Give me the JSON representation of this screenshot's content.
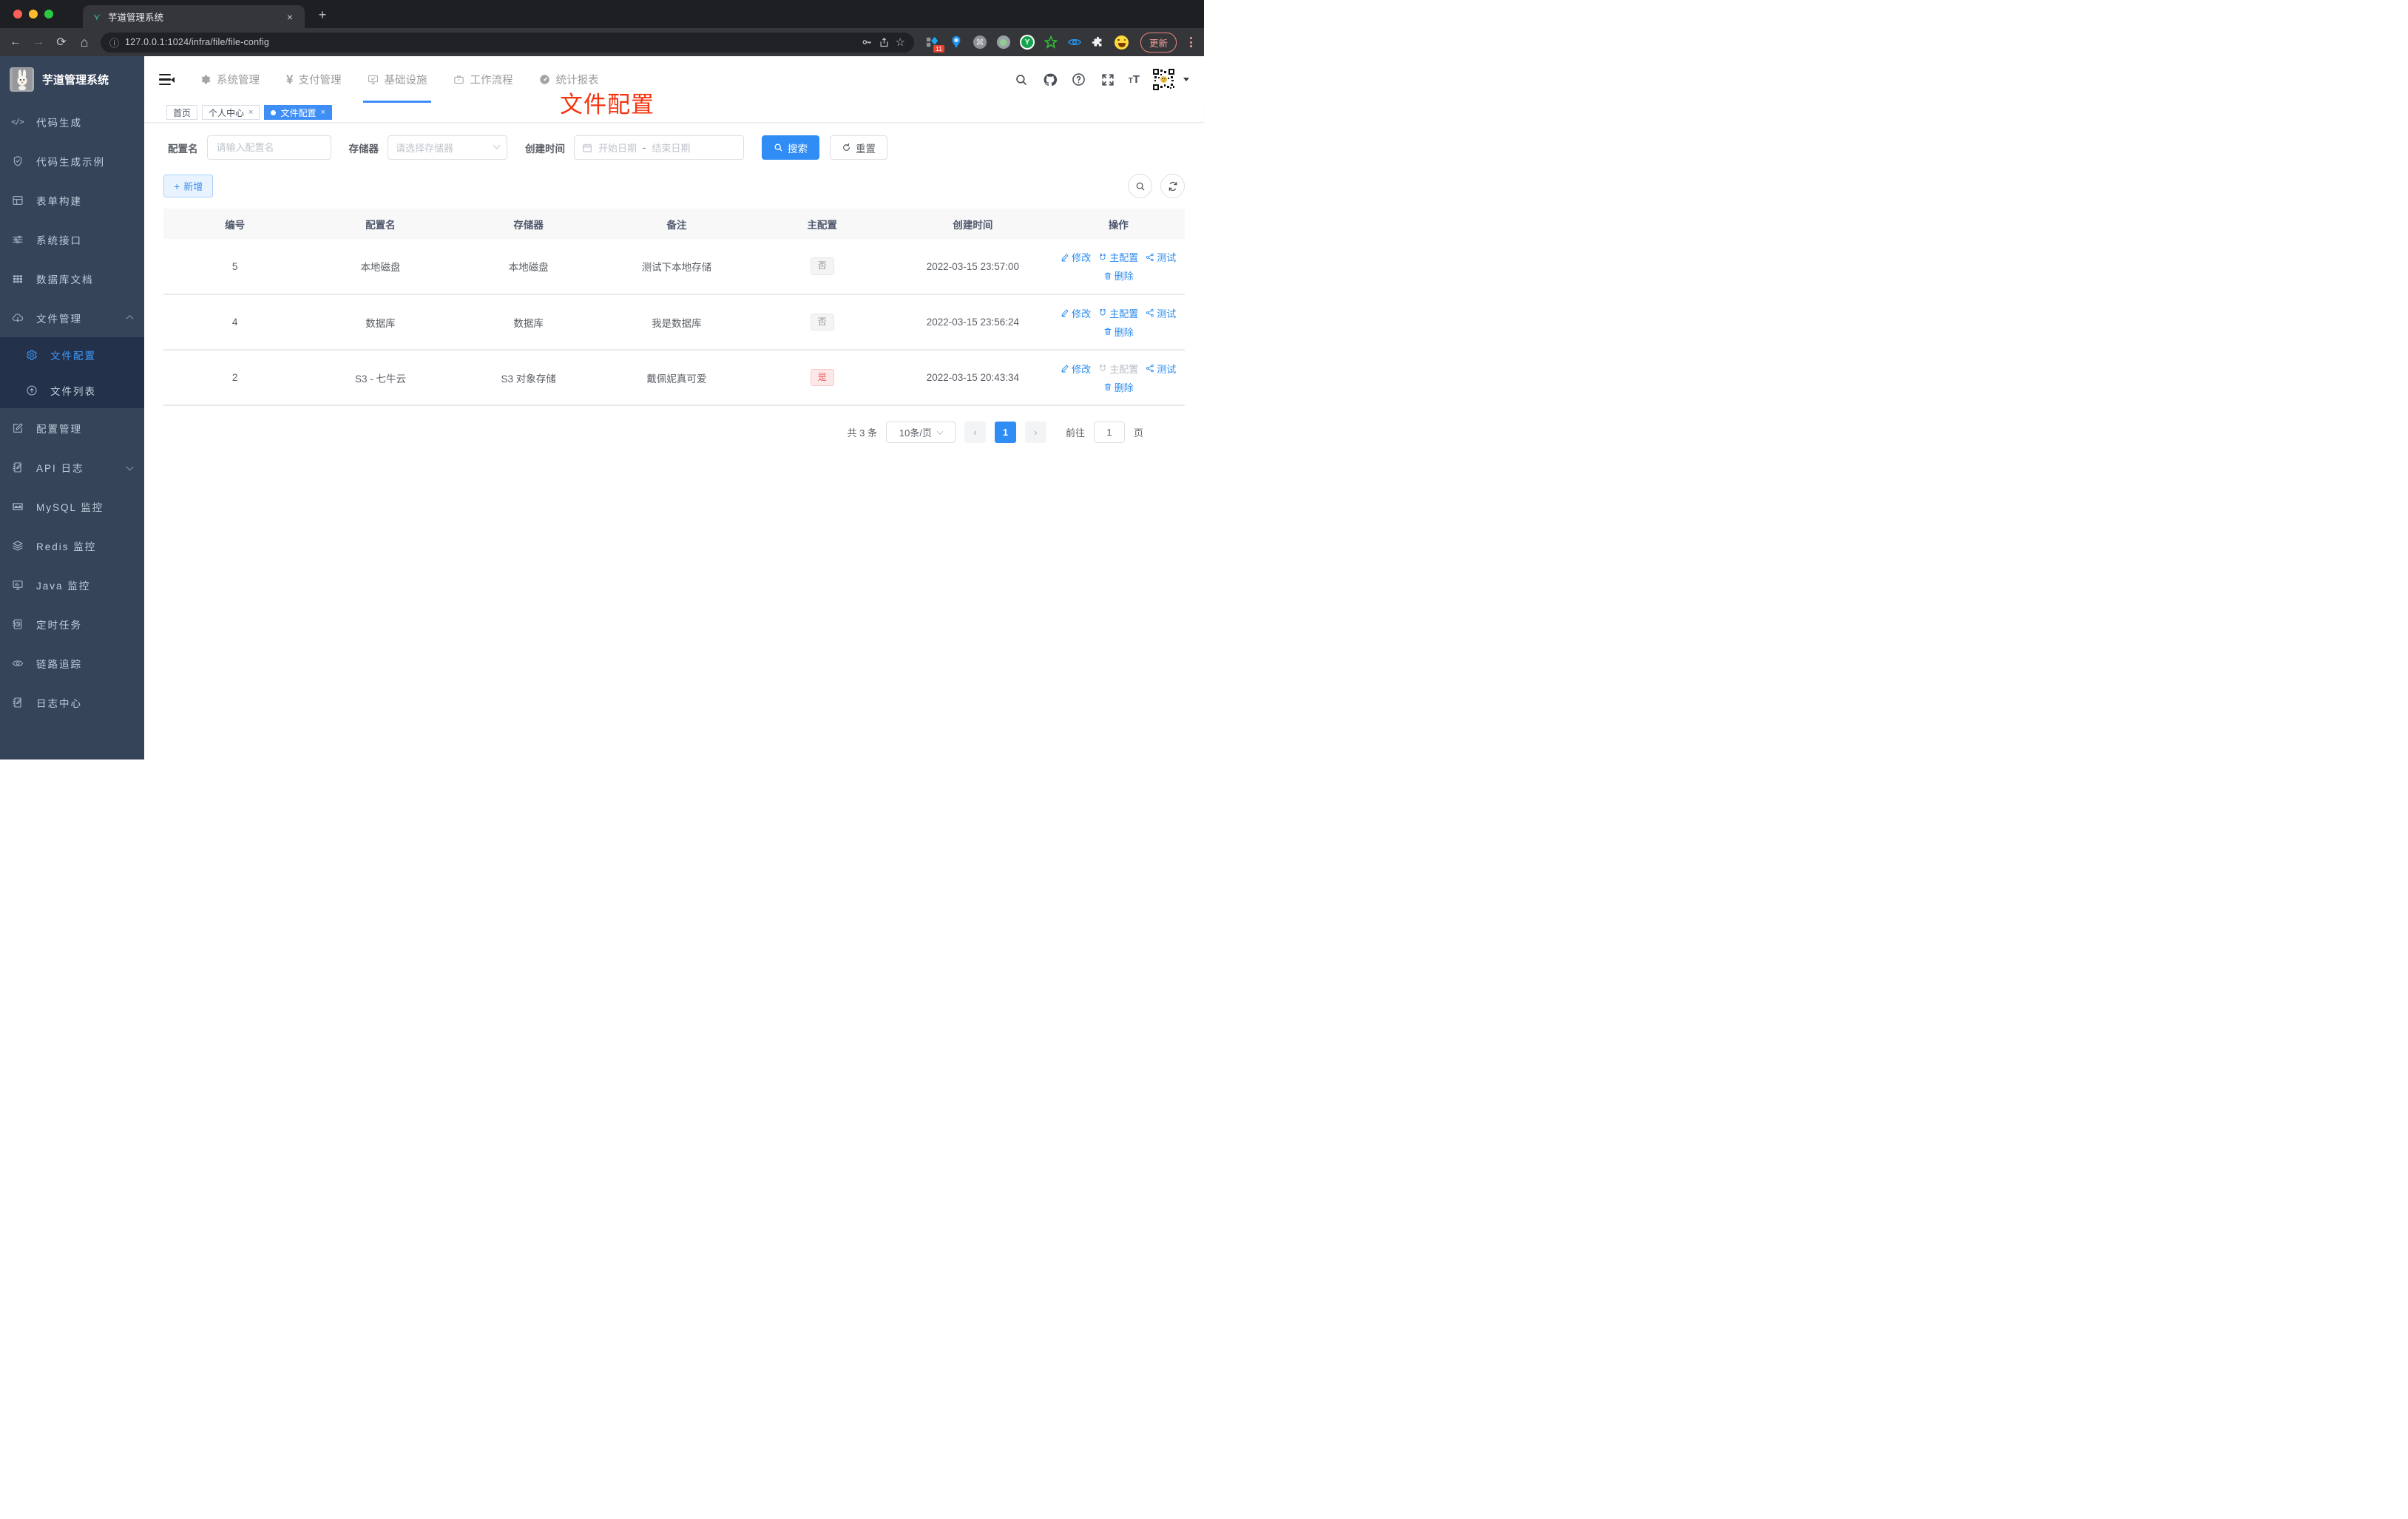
{
  "browser": {
    "tab_title": "芋道管理系统",
    "url": "127.0.0.1:1024/infra/file/file-config",
    "extensions_badge": "11",
    "update_label": "更新"
  },
  "sidebar": {
    "title": "芋道管理系统",
    "items": [
      {
        "label": "代码生成"
      },
      {
        "label": "代码生成示例"
      },
      {
        "label": "表单构建"
      },
      {
        "label": "系统接口"
      },
      {
        "label": "数据库文档"
      },
      {
        "label": "文件管理"
      },
      {
        "label": "文件配置"
      },
      {
        "label": "文件列表"
      },
      {
        "label": "配置管理"
      },
      {
        "label": "API 日志"
      },
      {
        "label": "MySQL 监控"
      },
      {
        "label": "Redis 监控"
      },
      {
        "label": "Java 监控"
      },
      {
        "label": "定时任务"
      },
      {
        "label": "链路追踪"
      },
      {
        "label": "日志中心"
      }
    ]
  },
  "topnav": {
    "items": [
      {
        "label": "系统管理"
      },
      {
        "label": "支付管理"
      },
      {
        "label": "基础设施"
      },
      {
        "label": "工作流程"
      },
      {
        "label": "统计报表"
      }
    ]
  },
  "tags": [
    {
      "label": "首页"
    },
    {
      "label": "个人中心"
    },
    {
      "label": "文件配置"
    }
  ],
  "annotation": {
    "text": "文件配置"
  },
  "filters": {
    "name_label": "配置名",
    "name_placeholder": "请输入配置名",
    "storage_label": "存储器",
    "storage_placeholder": "请选择存储器",
    "date_label": "创建时间",
    "date_start_placeholder": "开始日期",
    "date_separator": "-",
    "date_end_placeholder": "结束日期",
    "search_label": "搜索",
    "reset_label": "重置"
  },
  "toolbar": {
    "add_label": "新增"
  },
  "table": {
    "columns": [
      "编号",
      "配置名",
      "存储器",
      "备注",
      "主配置",
      "创建时间",
      "操作"
    ],
    "actions": {
      "edit": "修改",
      "master": "主配置",
      "test": "测试",
      "delete": "删除"
    },
    "rows": [
      {
        "id": "5",
        "name": "本地磁盘",
        "storage": "本地磁盘",
        "remark": "测试下本地存储",
        "master": "否",
        "master_danger": false,
        "master_disabled": false,
        "created": "2022-03-15 23:57:00"
      },
      {
        "id": "4",
        "name": "数据库",
        "storage": "数据库",
        "remark": "我是数据库",
        "master": "否",
        "master_danger": false,
        "master_disabled": false,
        "created": "2022-03-15 23:56:24"
      },
      {
        "id": "2",
        "name": "S3 - 七牛云",
        "storage": "S3 对象存储",
        "remark": "戴佩妮真可爱",
        "master": "是",
        "master_danger": true,
        "master_disabled": true,
        "created": "2022-03-15 20:43:34"
      }
    ]
  },
  "pagination": {
    "total": "共 3 条",
    "page_size": "10条/页",
    "page": "1",
    "goto_label": "前往",
    "goto_value": "1",
    "unit": "页"
  },
  "colors": {
    "primary": "#2f8df5",
    "sidebar_bg": "#36445a",
    "submenu_bg": "#24314a",
    "annotation_red": "#f4330f",
    "tag_info_text": "#909399",
    "tag_danger_text": "#f25a5a"
  }
}
